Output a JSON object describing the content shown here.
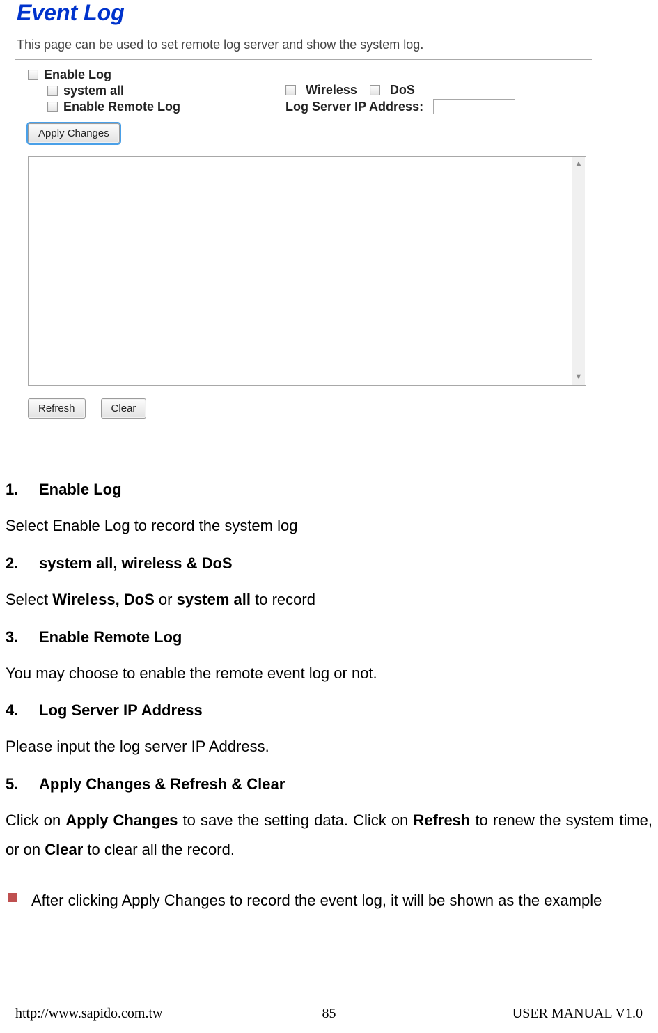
{
  "panel": {
    "title": "Event Log",
    "description": "This page can be used to set remote log server and show the system log.",
    "enable_log_label": "Enable Log",
    "system_all_label": "system all",
    "enable_remote_log_label": "Enable Remote Log",
    "wireless_label": "Wireless",
    "dos_label": "DoS",
    "log_server_ip_label": "Log Server IP Address:",
    "apply_changes_btn": "Apply Changes",
    "refresh_btn": "Refresh",
    "clear_btn": "Clear"
  },
  "doc": {
    "h1_num": "1.",
    "h1_title": "Enable Log",
    "p1": "Select Enable Log to record the system log",
    "h2_num": "2.",
    "h2_title": "system all, wireless & DoS",
    "p2_pre": "Select ",
    "p2_b1": "Wireless, DoS",
    "p2_mid": " or ",
    "p2_b2": "system all",
    "p2_post": " to record",
    "h3_num": "3.",
    "h3_title": "Enable Remote Log",
    "p3": "You may choose to enable the remote event log or not.",
    "h4_num": "4.",
    "h4_title": "Log Server IP Address",
    "p4": "Please input the log server IP Address.",
    "h5_num": "5.",
    "h5_title": "Apply Changes & Refresh & Clear",
    "p5_1": "Click on ",
    "p5_b1": "Apply Changes",
    "p5_2": " to save the setting data. Click on ",
    "p5_b2": "Refresh",
    "p5_3": " to renew the system time, or on ",
    "p5_b3": "Clear",
    "p5_4": " to clear all the record.",
    "bullet_1": "After clicking ",
    "bullet_b": "Apply Changes",
    "bullet_2": " to record the event log, it will be shown as the example"
  },
  "footer": {
    "left": "http://www.sapido.com.tw",
    "center": "85",
    "right": "USER MANUAL V1.0"
  }
}
